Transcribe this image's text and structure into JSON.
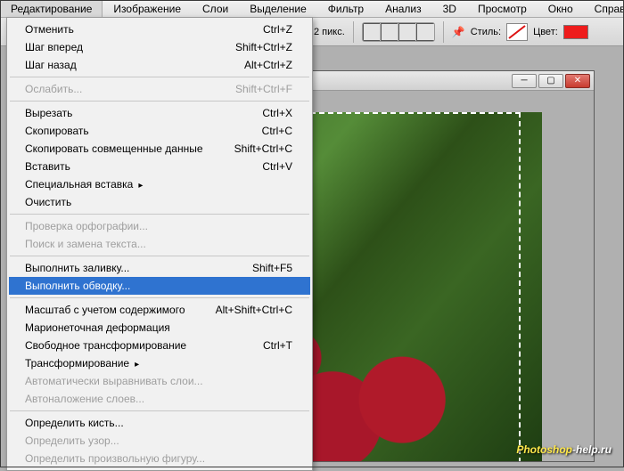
{
  "menubar": {
    "items": [
      "Редактирование",
      "Изображение",
      "Слои",
      "Выделение",
      "Фильтр",
      "Анализ",
      "3D",
      "Просмотр",
      "Окно",
      "Справка"
    ],
    "open_index": 0
  },
  "toolbar": {
    "px_value": "2 пикс.",
    "style_label": "Стиль:",
    "color_label": "Цвет:",
    "color_value": "#ee1c1c"
  },
  "dropdown": {
    "groups": [
      [
        {
          "label": "Отменить",
          "shortcut": "Ctrl+Z",
          "enabled": true
        },
        {
          "label": "Шаг вперед",
          "shortcut": "Shift+Ctrl+Z",
          "enabled": true
        },
        {
          "label": "Шаг назад",
          "shortcut": "Alt+Ctrl+Z",
          "enabled": true
        }
      ],
      [
        {
          "label": "Ослабить...",
          "shortcut": "Shift+Ctrl+F",
          "enabled": false
        }
      ],
      [
        {
          "label": "Вырезать",
          "shortcut": "Ctrl+X",
          "enabled": true
        },
        {
          "label": "Скопировать",
          "shortcut": "Ctrl+C",
          "enabled": true
        },
        {
          "label": "Скопировать совмещенные данные",
          "shortcut": "Shift+Ctrl+C",
          "enabled": true
        },
        {
          "label": "Вставить",
          "shortcut": "Ctrl+V",
          "enabled": true
        },
        {
          "label": "Специальная вставка",
          "submenu": true,
          "enabled": true
        },
        {
          "label": "Очистить",
          "enabled": true
        }
      ],
      [
        {
          "label": "Проверка орфографии...",
          "enabled": false
        },
        {
          "label": "Поиск и замена текста...",
          "enabled": false
        }
      ],
      [
        {
          "label": "Выполнить заливку...",
          "shortcut": "Shift+F5",
          "enabled": true
        },
        {
          "label": "Выполнить обводку...",
          "enabled": true,
          "highlight": true
        }
      ],
      [
        {
          "label": "Масштаб с учетом содержимого",
          "shortcut": "Alt+Shift+Ctrl+C",
          "enabled": true
        },
        {
          "label": "Марионеточная деформация",
          "enabled": true
        },
        {
          "label": "Свободное трансформирование",
          "shortcut": "Ctrl+T",
          "enabled": true
        },
        {
          "label": "Трансформирование",
          "submenu": true,
          "enabled": true
        },
        {
          "label": "Автоматически выравнивать слои...",
          "enabled": false
        },
        {
          "label": "Автоналожение слоев...",
          "enabled": false
        }
      ],
      [
        {
          "label": "Определить кисть...",
          "enabled": true
        },
        {
          "label": "Определить узор...",
          "enabled": false
        },
        {
          "label": "Определить произвольную фигуру...",
          "enabled": false
        }
      ]
    ]
  },
  "watermark": {
    "a": "Photoshop",
    "b": "-help.ru"
  }
}
